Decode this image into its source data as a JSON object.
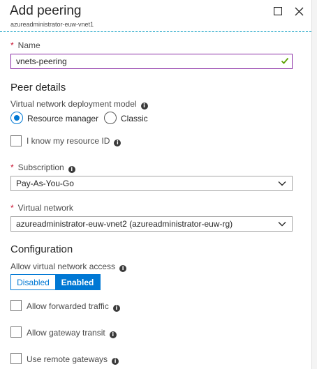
{
  "header": {
    "title": "Add peering",
    "subtitle": "azureadministrator-euw-vnet1"
  },
  "name_field": {
    "required_mark": "*",
    "label": "Name",
    "value": "vnets-peering"
  },
  "peer_details": {
    "heading": "Peer details",
    "deployment_model_label": "Virtual network deployment model",
    "options": [
      "Resource manager",
      "Classic"
    ],
    "selected": "Resource manager",
    "resource_id_label": "I know my resource ID"
  },
  "subscription": {
    "required_mark": "*",
    "label": "Subscription",
    "value": "Pay-As-You-Go"
  },
  "virtual_network": {
    "required_mark": "*",
    "label": "Virtual network",
    "value": "azureadministrator-euw-vnet2 (azureadministrator-euw-rg)"
  },
  "configuration": {
    "heading": "Configuration",
    "access_label": "Allow virtual network access",
    "toggle_off": "Disabled",
    "toggle_on": "Enabled",
    "selected": "Enabled",
    "forwarded_label": "Allow forwarded traffic",
    "gateway_transit_label": "Allow gateway transit",
    "remote_gateways_label": "Use remote gateways"
  },
  "info_glyph": "i",
  "colors": {
    "accent": "#0078d4",
    "required": "#c8102e",
    "valid": "#5aa000",
    "focus_border": "#8a2da5"
  }
}
